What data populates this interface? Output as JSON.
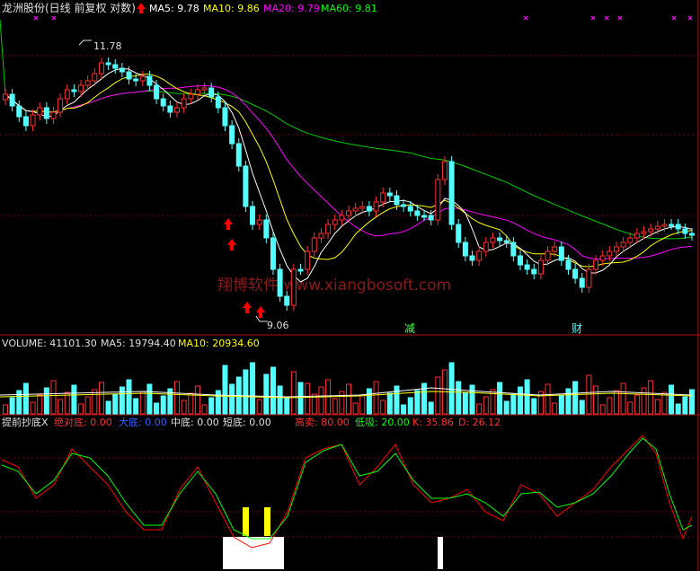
{
  "header": {
    "stock_title": "龙洲股份(日线 前复权 对数)",
    "ma5": "MA5: 9.78",
    "ma10": "MA10: 9.86",
    "ma20": "MA20: 9.79",
    "ma60": "MA60: 9.81",
    "high_label": "11.78",
    "low_label": "9.06",
    "marker_jian": "减",
    "marker_cai": "财",
    "watermark": "翔博软件 www.xiangbosoft.com"
  },
  "volume": {
    "volume": "VOLUME: 41101.30",
    "ma5": "MA5: 19794.40",
    "ma10": "MA10: 20934.60"
  },
  "indicator": {
    "name": "提前抄底X",
    "juedui": "绝对底: 0.00",
    "dadi": "大底: 0.00",
    "zhongdi": "中底: 0.00",
    "duandi": "短底: 0.00",
    "gaomai": "高卖: 80.00",
    "dixi": "低吸: 20.00",
    "k": "K: 35.86",
    "d": "D: 26.12"
  },
  "colors": {
    "up": "#ff3030",
    "down": "#54ffff",
    "ma5": "#ffffff",
    "ma10": "#ffff00",
    "ma20": "#ff00ff",
    "ma60": "#00cc00",
    "grid": "#8b0000",
    "k_line": "#ff0000",
    "d_line": "#00ff00"
  }
}
